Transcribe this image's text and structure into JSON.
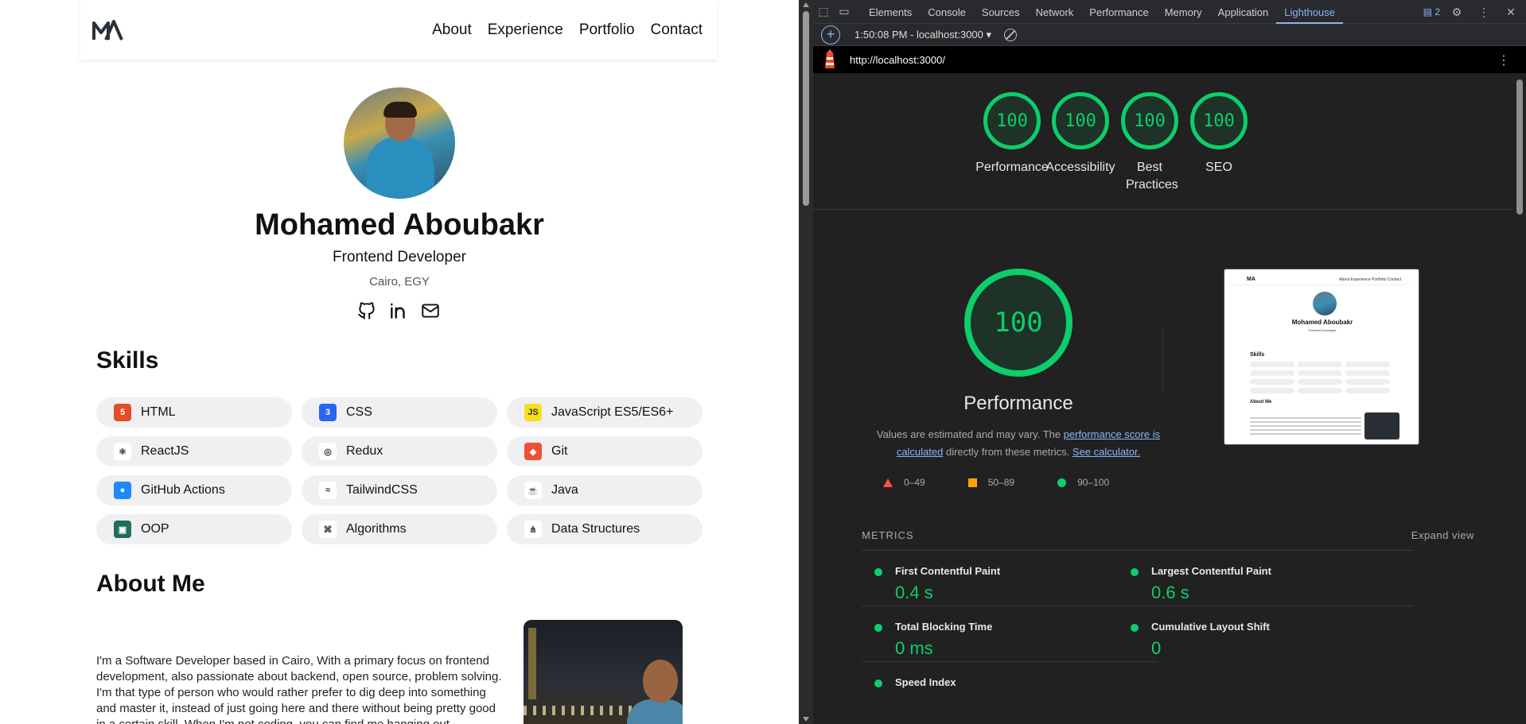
{
  "page": {
    "logo_text": "MA",
    "nav": [
      "About",
      "Experience",
      "Portfolio",
      "Contact"
    ],
    "name": "Mohamed Aboubakr",
    "role": "Frontend Developer",
    "location": "Cairo, EGY",
    "skills_title": "Skills",
    "skills": [
      {
        "label": "HTML",
        "icon": "html5-icon",
        "badge": "5",
        "color": "#e44d26"
      },
      {
        "label": "CSS",
        "icon": "css3-icon",
        "badge": "3",
        "color": "#2965f1"
      },
      {
        "label": "JavaScript ES5/ES6+",
        "icon": "javascript-icon",
        "badge": "JS",
        "color": "#f7df1e"
      },
      {
        "label": "ReactJS",
        "icon": "react-icon",
        "badge": "⚛",
        "color": "#ffffff"
      },
      {
        "label": "Redux",
        "icon": "redux-icon",
        "badge": "◎",
        "color": "#ffffff"
      },
      {
        "label": "Git",
        "icon": "git-icon",
        "badge": "◆",
        "color": "#f05032"
      },
      {
        "label": "GitHub Actions",
        "icon": "github-actions-icon",
        "badge": "●",
        "color": "#2088ff"
      },
      {
        "label": "TailwindCSS",
        "icon": "tailwind-icon",
        "badge": "≈",
        "color": "#ffffff"
      },
      {
        "label": "Java",
        "icon": "java-icon",
        "badge": "☕",
        "color": "#ffffff"
      },
      {
        "label": "OOP",
        "icon": "oop-icon",
        "badge": "▣",
        "color": "#1f6f5c"
      },
      {
        "label": "Algorithms",
        "icon": "algorithms-icon",
        "badge": "⌘",
        "color": "#ffffff"
      },
      {
        "label": "Data Structures",
        "icon": "data-structures-icon",
        "badge": "⋔",
        "color": "#ffffff"
      }
    ],
    "about_title": "About Me",
    "about_text": "I'm a Software Developer based in Cairo, With a primary focus on frontend development, also passionate about backend, open source, problem solving. I'm that type of person who would rather prefer to dig deep into something and master it, instead of just going here and there without being pretty good in a certain skill. When I'm not coding, you can find me hanging out"
  },
  "devtools": {
    "tabs": [
      "Elements",
      "Console",
      "Sources",
      "Network",
      "Performance",
      "Memory",
      "Application",
      "Lighthouse"
    ],
    "active_tab": "Lighthouse",
    "issues_badge": "2",
    "report_select": "1:50:08 PM - localhost:3000",
    "url": "http://localhost:3000/",
    "summary_gauges": [
      {
        "score": "100",
        "label": "Performance"
      },
      {
        "score": "100",
        "label": "Accessibility"
      },
      {
        "score": "100",
        "label": "Best Practices"
      },
      {
        "score": "100",
        "label": "SEO"
      }
    ],
    "main_score": "100",
    "main_label": "Performance",
    "estimate_prefix": "Values are estimated and may vary. The ",
    "estimate_link1": "performance score is calculated",
    "estimate_mid": " directly from these metrics. ",
    "estimate_link2": "See calculator.",
    "legend": [
      "0–49",
      "50–89",
      "90–100"
    ],
    "thumbnail": {
      "name": "Mohamed Aboubakr",
      "role": "Frontend Developer",
      "skills_title": "Skills",
      "about_title": "About Me",
      "nav": "About  Experience  Portfolio  Contact"
    },
    "metrics_title": "METRICS",
    "expand_label": "Expand view",
    "metrics": [
      {
        "name": "First Contentful Paint",
        "value": "0.4 s"
      },
      {
        "name": "Largest Contentful Paint",
        "value": "0.6 s"
      },
      {
        "name": "Total Blocking Time",
        "value": "0 ms"
      },
      {
        "name": "Cumulative Layout Shift",
        "value": "0"
      },
      {
        "name": "Speed Index",
        "value": ""
      }
    ],
    "colors": {
      "pass": "#0cce6b",
      "average": "#ffa400",
      "fail": "#ff4e42",
      "link": "#8ab4f8"
    }
  }
}
